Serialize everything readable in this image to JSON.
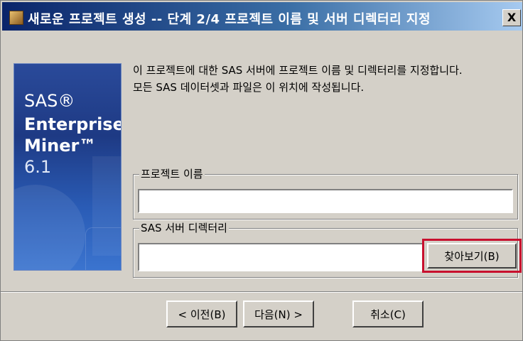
{
  "window": {
    "title": "새로운 프로젝트 생성 -- 단계 2/4 프로젝트 이름 및 서버 디렉터리 지정",
    "close_label": "X"
  },
  "brand": {
    "sas": "SAS®",
    "line1": "Enterprise",
    "line2": "Miner™",
    "version": "6.1"
  },
  "description": {
    "line1": "이 프로젝트에 대한 SAS 서버에 프로젝트 이름 및 디렉터리를 지정합니다.",
    "line2": "모든 SAS 데이터셋과 파일은 이 위치에 작성됩니다."
  },
  "project_name": {
    "label": "프로젝트 이름",
    "value": ""
  },
  "server_dir": {
    "label": "SAS 서버 디렉터리",
    "value": "",
    "browse_label": "찾아보기(B)"
  },
  "buttons": {
    "back": "< 이전(B)",
    "next": "다음(N) >",
    "cancel": "취소(C)"
  },
  "colors": {
    "highlight": "#c8102e",
    "titlebar": "#0a246a",
    "dialog_bg": "#d4d0c8"
  }
}
